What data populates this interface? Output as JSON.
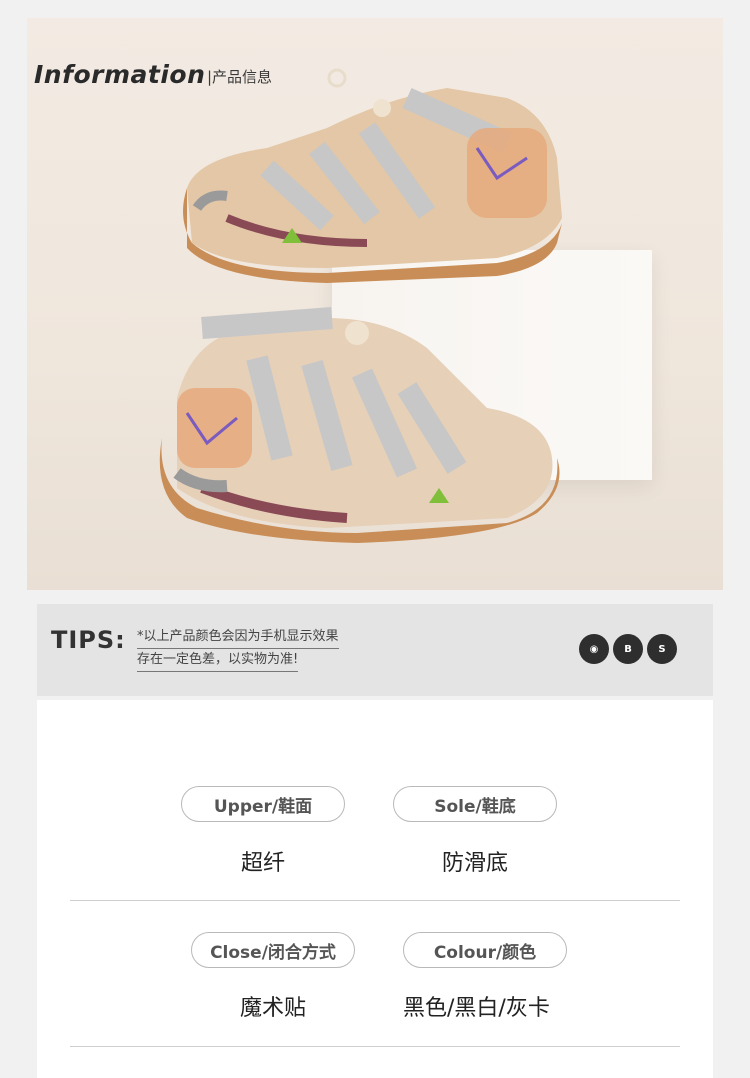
{
  "hero": {
    "title": "Information",
    "subtitle": "|产品信息"
  },
  "tips": {
    "label": "TIPS:",
    "line1": "*以上产品颜色会因为手机显示效果",
    "line2": "存在一定色差，以实物为准!",
    "badges": [
      "◉",
      "B",
      "S"
    ]
  },
  "specs": [
    {
      "label": "Upper/鞋面",
      "value": "超纤"
    },
    {
      "label": "Sole/鞋底",
      "value": "防滑底"
    },
    {
      "label": "Close/闭合方式",
      "value": "魔术贴"
    },
    {
      "label": "Colour/颜色",
      "value": "黑色/黑白/灰卡"
    }
  ],
  "colors": {
    "accent_tan": "#c98e57",
    "strap_grey": "#c7c7c7",
    "sole_maroon": "#8a4a55"
  }
}
